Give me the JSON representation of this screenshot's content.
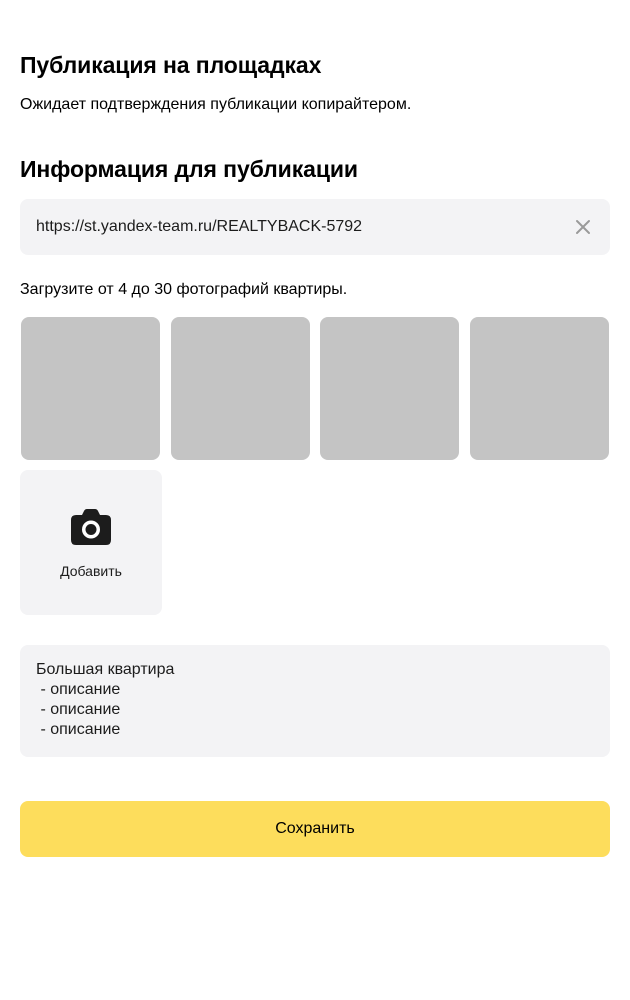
{
  "publication": {
    "title": "Публикация на площадках",
    "status": "Ожидает подтверждения публикации копирайтером."
  },
  "info": {
    "title": "Информация для публикации",
    "url_value": "https://st.yandex-team.ru/REALTYBACK-5792",
    "clear_icon": "close-icon",
    "photos_hint": "Загрузите от 4 до 30 фотографий квартиры.",
    "photos": [
      {
        "placeholder_color": "#c4c4c4"
      },
      {
        "placeholder_color": "#c4c4c4"
      },
      {
        "placeholder_color": "#c4c4c4"
      },
      {
        "placeholder_color": "#c4c4c4"
      }
    ],
    "add_photo": {
      "icon": "camera-icon",
      "label": "Добавить"
    },
    "description": "Большая квартира\n - описание\n - описание\n - описание"
  },
  "actions": {
    "save_label": "Сохранить"
  },
  "colors": {
    "accent": "#fddd5c",
    "field_bg": "#f3f3f5",
    "photo_placeholder": "#c4c4c4"
  }
}
